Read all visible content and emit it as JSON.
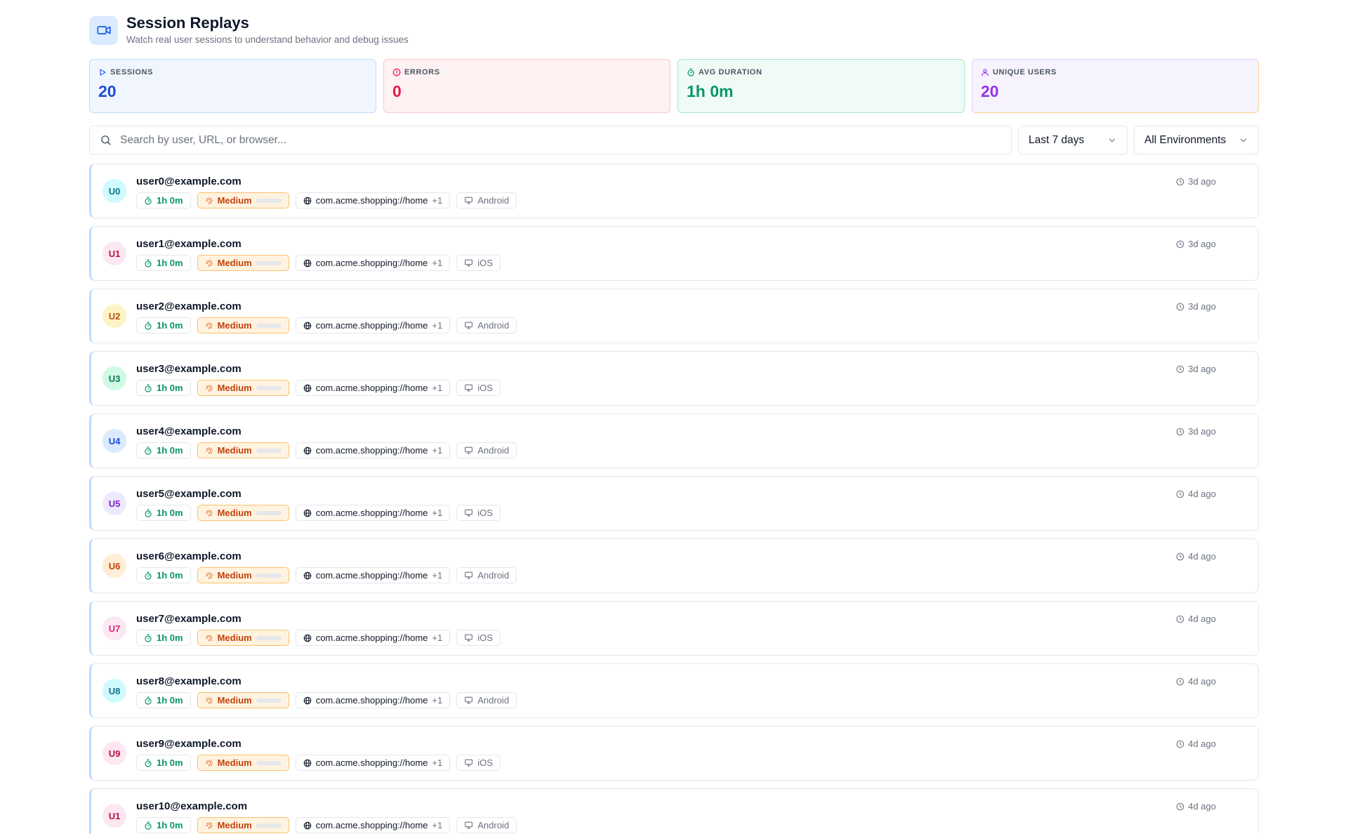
{
  "header": {
    "title": "Session Replays",
    "subtitle": "Watch real user sessions to understand behavior and debug issues",
    "icon": "video-camera-icon"
  },
  "stats": {
    "sessions": {
      "label": "SESSIONS",
      "value": "20",
      "color": "#1d4ed8"
    },
    "errors": {
      "label": "ERRORS",
      "value": "0",
      "color": "#e11d48"
    },
    "avg_duration": {
      "label": "AVG DURATION",
      "value": "1h 0m",
      "color": "#059669"
    },
    "unique_users": {
      "label": "UNIQUE USERS",
      "value": "20",
      "color": "#9333ea"
    }
  },
  "toolbar": {
    "search_placeholder": "Search by user, URL, or browser...",
    "date_range": "Last 7 days",
    "environment": "All Environments"
  },
  "sessions": [
    {
      "initials": "U0",
      "email": "user0@example.com",
      "duration": "1h 0m",
      "level": "Medium",
      "level_fill": 0.5,
      "url": "com.acme.shopping://home",
      "extra": "+1",
      "device": "Android",
      "time": "3d ago",
      "avatar_bg": "#cffafe",
      "avatar_fg": "#0e7490"
    },
    {
      "initials": "U1",
      "email": "user1@example.com",
      "duration": "1h 0m",
      "level": "Medium",
      "level_fill": 0.5,
      "url": "com.acme.shopping://home",
      "extra": "+1",
      "device": "iOS",
      "time": "3d ago",
      "avatar_bg": "#fce7f3",
      "avatar_fg": "#be123c"
    },
    {
      "initials": "U2",
      "email": "user2@example.com",
      "duration": "1h 0m",
      "level": "Medium",
      "level_fill": 0.5,
      "url": "com.acme.shopping://home",
      "extra": "+1",
      "device": "Android",
      "time": "3d ago",
      "avatar_bg": "#fef3c7",
      "avatar_fg": "#b45309"
    },
    {
      "initials": "U3",
      "email": "user3@example.com",
      "duration": "1h 0m",
      "level": "Medium",
      "level_fill": 0.5,
      "url": "com.acme.shopping://home",
      "extra": "+1",
      "device": "iOS",
      "time": "3d ago",
      "avatar_bg": "#d1fae5",
      "avatar_fg": "#047857"
    },
    {
      "initials": "U4",
      "email": "user4@example.com",
      "duration": "1h 0m",
      "level": "Medium",
      "level_fill": 0.5,
      "url": "com.acme.shopping://home",
      "extra": "+1",
      "device": "Android",
      "time": "3d ago",
      "avatar_bg": "#dbeafe",
      "avatar_fg": "#1d4ed8"
    },
    {
      "initials": "U5",
      "email": "user5@example.com",
      "duration": "1h 0m",
      "level": "Medium",
      "level_fill": 0.5,
      "url": "com.acme.shopping://home",
      "extra": "+1",
      "device": "iOS",
      "time": "4d ago",
      "avatar_bg": "#ede9fe",
      "avatar_fg": "#7e22ce"
    },
    {
      "initials": "U6",
      "email": "user6@example.com",
      "duration": "1h 0m",
      "level": "Medium",
      "level_fill": 0.5,
      "url": "com.acme.shopping://home",
      "extra": "+1",
      "device": "Android",
      "time": "4d ago",
      "avatar_bg": "#ffedd5",
      "avatar_fg": "#c2410c"
    },
    {
      "initials": "U7",
      "email": "user7@example.com",
      "duration": "1h 0m",
      "level": "Medium",
      "level_fill": 0.5,
      "url": "com.acme.shopping://home",
      "extra": "+1",
      "device": "iOS",
      "time": "4d ago",
      "avatar_bg": "#fce7f3",
      "avatar_fg": "#db2777"
    },
    {
      "initials": "U8",
      "email": "user8@example.com",
      "duration": "1h 0m",
      "level": "Medium",
      "level_fill": 0.5,
      "url": "com.acme.shopping://home",
      "extra": "+1",
      "device": "Android",
      "time": "4d ago",
      "avatar_bg": "#cffafe",
      "avatar_fg": "#0e7490"
    },
    {
      "initials": "U9",
      "email": "user9@example.com",
      "duration": "1h 0m",
      "level": "Medium",
      "level_fill": 0.5,
      "url": "com.acme.shopping://home",
      "extra": "+1",
      "device": "iOS",
      "time": "4d ago",
      "avatar_bg": "#fce7f3",
      "avatar_fg": "#be123c"
    },
    {
      "initials": "U1",
      "email": "user10@example.com",
      "duration": "1h 0m",
      "level": "Medium",
      "level_fill": 0.5,
      "url": "com.acme.shopping://home",
      "extra": "+1",
      "device": "Android",
      "time": "4d ago",
      "avatar_bg": "#fce7f3",
      "avatar_fg": "#be123c"
    }
  ]
}
